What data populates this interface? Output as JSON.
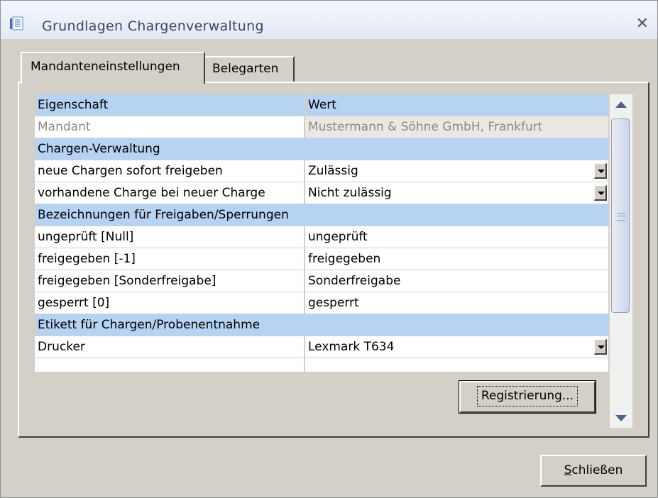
{
  "window": {
    "title": "Grundlagen Chargenverwaltung",
    "icon": "properties-list-icon",
    "close_icon": "close-icon"
  },
  "tabs": [
    {
      "label": "Mandanteneinstellungen",
      "active": true
    },
    {
      "label": "Belegarten",
      "active": false
    }
  ],
  "grid": {
    "columns": [
      "Eigenschaft",
      "Wert"
    ],
    "rows": [
      {
        "type": "disabled",
        "name": "Mandant",
        "value": "Mustermann & Söhne GmbH, Frankfurt"
      },
      {
        "type": "section",
        "name": "Chargen-Verwaltung"
      },
      {
        "type": "dropdown",
        "name": "neue Chargen sofort freigeben",
        "value": "Zulässig"
      },
      {
        "type": "dropdown",
        "name": "vorhandene Charge bei neuer Charge",
        "value": "Nicht zulässig"
      },
      {
        "type": "section",
        "name": "Bezeichnungen für Freigaben/Sperrungen"
      },
      {
        "type": "text",
        "name": "ungeprüft [Null]",
        "value": "ungeprüft"
      },
      {
        "type": "text",
        "name": "freigegeben [-1]",
        "value": "freigegeben"
      },
      {
        "type": "text",
        "name": "freigegeben [Sonderfreigabe]",
        "value": "Sonderfreigabe"
      },
      {
        "type": "text",
        "name": "gesperrt [0]",
        "value": "gesperrt"
      },
      {
        "type": "section",
        "name": "Etikett für Chargen/Probenentnahme"
      },
      {
        "type": "dropdown",
        "name": "Drucker",
        "value": "Lexmark T634"
      },
      {
        "type": "text",
        "name": "",
        "value": ""
      }
    ]
  },
  "buttons": {
    "register_label": "Registrierung...",
    "close_label": "Schließen"
  },
  "colors": {
    "window_bg": "#d4d0c8",
    "header_row_bg": "#b6d3f4",
    "title_text": "#3c4a66"
  }
}
